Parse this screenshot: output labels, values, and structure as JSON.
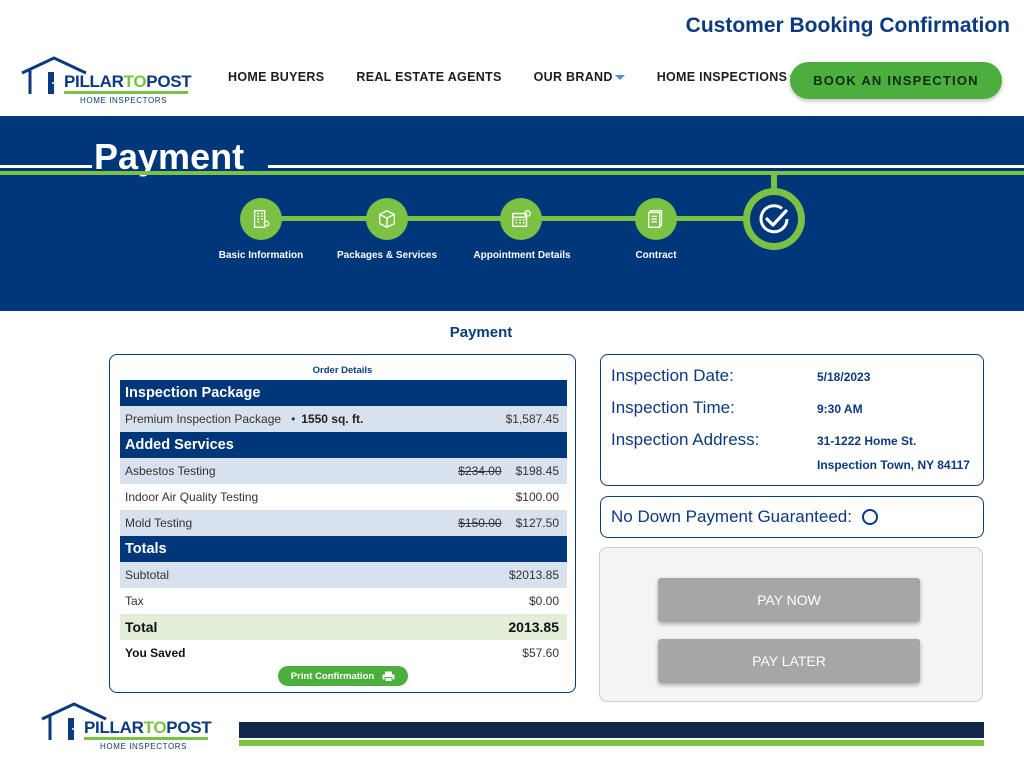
{
  "page_heading": "Customer Booking Confirmation",
  "brand": {
    "name_part1": "PILLAR",
    "name_part2": "TO",
    "name_part3": "POST",
    "tagline": "HOME INSPECTORS"
  },
  "nav": {
    "items": [
      "HOME BUYERS",
      "REAL ESTATE AGENTS",
      "OUR BRAND",
      "HOME INSPECTIONS"
    ],
    "cta": "BOOK AN INSPECTION"
  },
  "banner": {
    "title": "Payment",
    "steps": [
      "Basic Information",
      "Packages & Services",
      "Appointment Details",
      "Contract"
    ]
  },
  "section_title": "Payment",
  "order": {
    "title": "Order Details",
    "package_header": "Inspection Package",
    "package_name": "Premium Inspection Package",
    "package_size": "1550 sq. ft.",
    "package_price": "$1,587.45",
    "services_header": "Added Services",
    "services": [
      {
        "name": "Asbestos Testing",
        "original": "$234.00",
        "price": "$198.45"
      },
      {
        "name": "Indoor Air Quality Testing",
        "original": "",
        "price": "$100.00"
      },
      {
        "name": "Mold Testing",
        "original": "$150.00",
        "price": "$127.50"
      }
    ],
    "totals_header": "Totals",
    "subtotal_label": "Subtotal",
    "subtotal": "$2013.85",
    "tax_label": "Tax",
    "tax": "$0.00",
    "total_label": "Total",
    "total": "2013.85",
    "saved_label": "You Saved",
    "saved": "$57.60",
    "print_label": "Print Confirmation"
  },
  "inspection": {
    "date_label": "Inspection Date:",
    "date": "5/18/2023",
    "time_label": "Inspection Time:",
    "time": "9:30 AM",
    "address_label": "Inspection Address:",
    "address_line1": "31-1222 Home St.",
    "address_line2": "Inspection Town, NY 84117"
  },
  "no_down_payment_label": "No Down Payment Guaranteed:",
  "payment_buttons": {
    "pay_now": "PAY NOW",
    "pay_later": "PAY LATER"
  },
  "colors": {
    "navy": "#00367a",
    "green": "#7bc143",
    "button_green": "#4cae3c",
    "disabled_gray": "#a6a6a6"
  }
}
